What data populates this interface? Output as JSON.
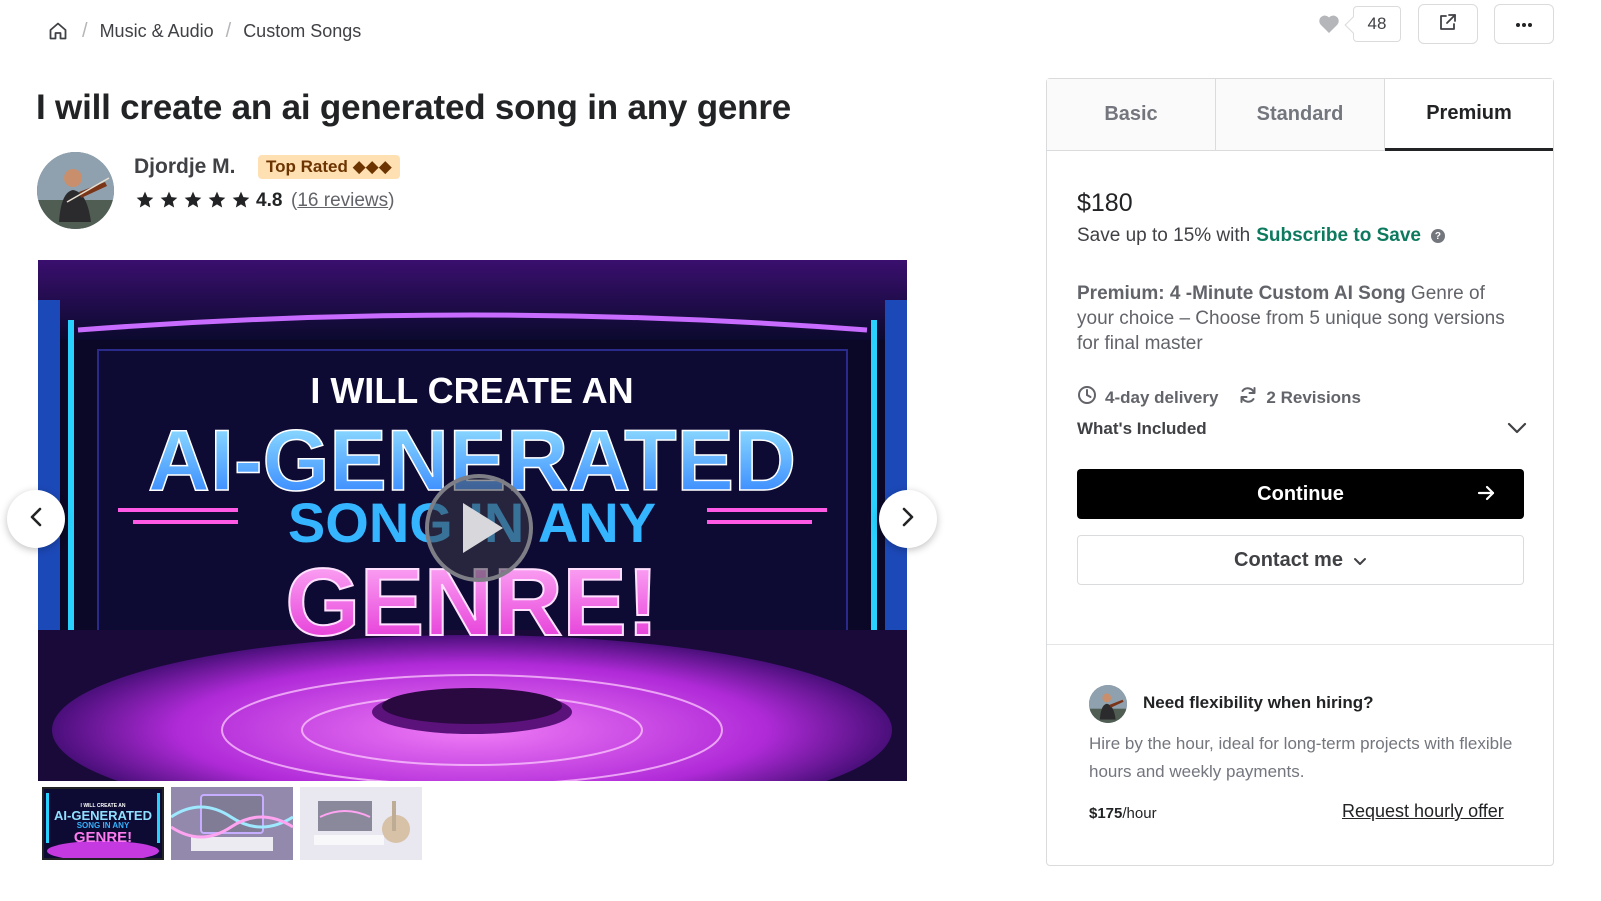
{
  "breadcrumb": {
    "home_icon": "home-icon",
    "items": [
      {
        "label": "Music & Audio"
      },
      {
        "label": "Custom Songs"
      }
    ]
  },
  "actions": {
    "like_icon": "heart-icon",
    "like_count": "48",
    "share_icon": "share-icon",
    "more_icon": "more-icon"
  },
  "gig": {
    "title": "I will create an ai generated song in any genre"
  },
  "seller": {
    "name": "Djordje M.",
    "badge": "Top Rated ◆◆◆",
    "rating": "4.8",
    "stars": 5,
    "reviews_open": "(",
    "reviews_link": "16 reviews",
    "reviews_close": ")"
  },
  "gallery": {
    "image_text": {
      "line1": "I WILL CREATE AN",
      "line2": "AI-GENERATED",
      "line3": "SONG IN ANY",
      "line4": "GENRE!"
    },
    "thumb1": {
      "line1": "I WILL CREATE AN",
      "line2": "AI-GENERATED",
      "line3": "SONG IN ANY",
      "line4": "GENRE!"
    },
    "play_icon": "play-icon",
    "prev_icon": "chevron-left-icon",
    "next_icon": "chevron-right-icon"
  },
  "package": {
    "tabs": [
      {
        "label": "Basic"
      },
      {
        "label": "Standard"
      },
      {
        "label": "Premium"
      }
    ],
    "active_tab": "Premium",
    "price": "$180",
    "save_text": "Save up to 15% with",
    "save_link": "Subscribe to Save",
    "help_icon": "?",
    "desc_title": "Premium: 4 -Minute Custom AI Song",
    "desc_body": " Genre of your choice – Choose from 5 unique song versions for final master",
    "delivery": "4-day delivery",
    "revisions": "2 Revisions",
    "whats_included": "What's Included",
    "continue_label": "Continue",
    "contact_label": "Contact me"
  },
  "flexibility": {
    "title": "Need flexibility when hiring?",
    "text": "Hire by the hour, ideal for long-term projects with flexible hours and weekly payments.",
    "rate": "$175",
    "rate_unit": "/hour",
    "request_label": "Request hourly offer"
  },
  "colors": {
    "accent_green": "#0d7a5f",
    "badge_bg": "#ffe0b3",
    "badge_text": "#6c3400",
    "button_black": "#000000"
  }
}
